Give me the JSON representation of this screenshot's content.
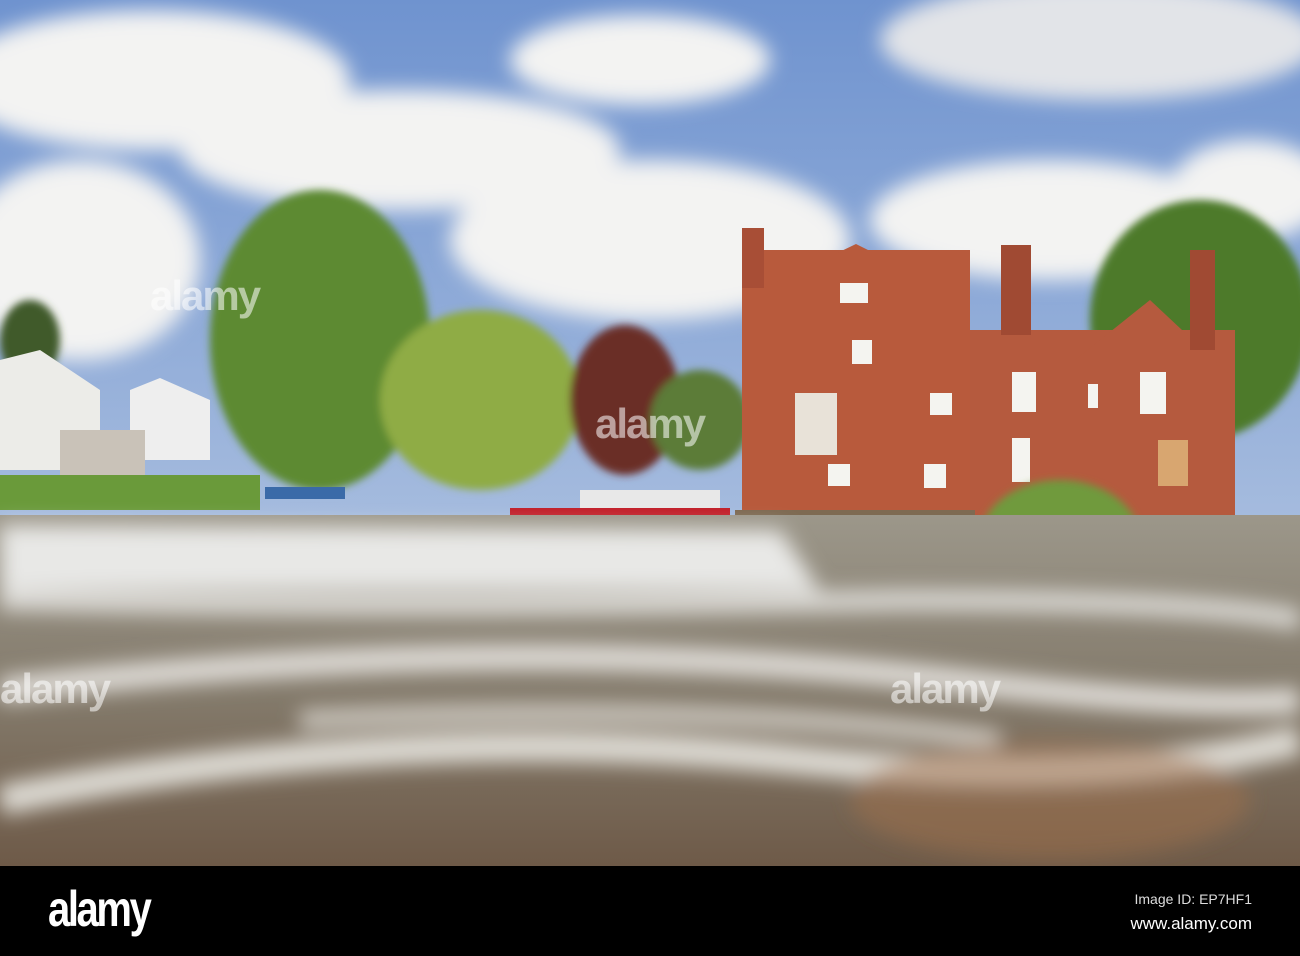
{
  "photo": {
    "subject": "mill-by-river-weir"
  },
  "watermark": {
    "text": "alamy"
  },
  "footer": {
    "logo": "alamy",
    "image_id": "Image ID: EP7HF1",
    "url": "www.alamy.com"
  }
}
